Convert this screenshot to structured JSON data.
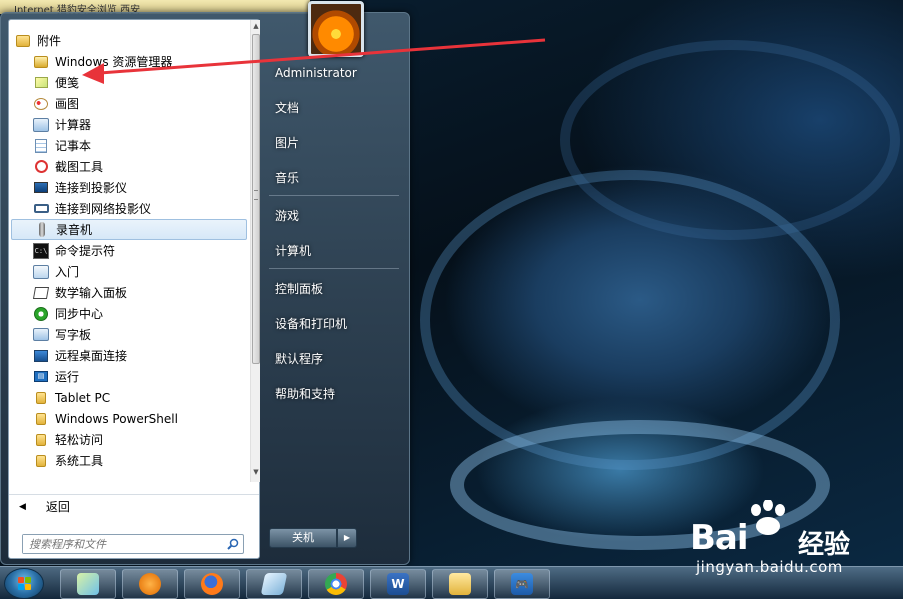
{
  "browser_strip": {
    "text": "Internet    猎豹安全浏览 西安"
  },
  "programs": {
    "items": [
      {
        "label": "附件",
        "icon": "folder-icon",
        "type": "header"
      },
      {
        "label": "Windows 资源管理器",
        "icon": "explorer-icon",
        "type": "sub"
      },
      {
        "label": "便笺",
        "icon": "sticky-notes-icon",
        "type": "sub"
      },
      {
        "label": "画图",
        "icon": "paint-icon",
        "type": "sub"
      },
      {
        "label": "计算器",
        "icon": "calculator-icon",
        "type": "sub"
      },
      {
        "label": "记事本",
        "icon": "notepad-icon",
        "type": "sub"
      },
      {
        "label": "截图工具",
        "icon": "snipping-tool-icon",
        "type": "sub"
      },
      {
        "label": "连接到投影仪",
        "icon": "projector-icon",
        "type": "sub"
      },
      {
        "label": "连接到网络投影仪",
        "icon": "network-projector-icon",
        "type": "sub"
      },
      {
        "label": "录音机",
        "icon": "sound-recorder-icon",
        "type": "sub",
        "selected": true
      },
      {
        "label": "命令提示符",
        "icon": "command-prompt-icon",
        "type": "sub"
      },
      {
        "label": "入门",
        "icon": "getting-started-icon",
        "type": "sub"
      },
      {
        "label": "数学输入面板",
        "icon": "math-input-icon",
        "type": "sub"
      },
      {
        "label": "同步中心",
        "icon": "sync-center-icon",
        "type": "sub"
      },
      {
        "label": "写字板",
        "icon": "wordpad-icon",
        "type": "sub"
      },
      {
        "label": "远程桌面连接",
        "icon": "remote-desktop-icon",
        "type": "sub"
      },
      {
        "label": "运行",
        "icon": "run-icon",
        "type": "sub"
      },
      {
        "label": "Tablet PC",
        "icon": "folder-icon",
        "type": "sub"
      },
      {
        "label": "Windows PowerShell",
        "icon": "folder-icon",
        "type": "sub"
      },
      {
        "label": "轻松访问",
        "icon": "folder-icon",
        "type": "sub"
      },
      {
        "label": "系统工具",
        "icon": "folder-icon",
        "type": "sub"
      }
    ]
  },
  "back": {
    "label": "返回"
  },
  "search": {
    "placeholder": "搜索程序和文件"
  },
  "right_pane": {
    "items": [
      {
        "label": "Administrator"
      },
      {
        "label": "文档"
      },
      {
        "label": "图片"
      },
      {
        "label": "音乐"
      },
      {
        "label": "游戏"
      },
      {
        "label": "计算机"
      },
      {
        "label": "控制面板"
      },
      {
        "label": "设备和打印机"
      },
      {
        "label": "默认程序"
      },
      {
        "label": "帮助和支持"
      }
    ]
  },
  "shutdown": {
    "label": "关机"
  },
  "taskbar": {
    "buttons": [
      {
        "name": "show-desktop-icon"
      },
      {
        "name": "cheetah-browser-icon"
      },
      {
        "name": "firefox-icon"
      },
      {
        "name": "notebook-icon"
      },
      {
        "name": "chrome-icon"
      },
      {
        "name": "word-icon",
        "text": "W"
      },
      {
        "name": "file-manager-icon"
      },
      {
        "name": "game-controller-icon"
      }
    ]
  },
  "watermark": {
    "url": "jingyan.baidu.com"
  },
  "colors": {
    "annotation": "#e8333a",
    "selection": "#d6e8f8",
    "accent": "#3c5366"
  }
}
